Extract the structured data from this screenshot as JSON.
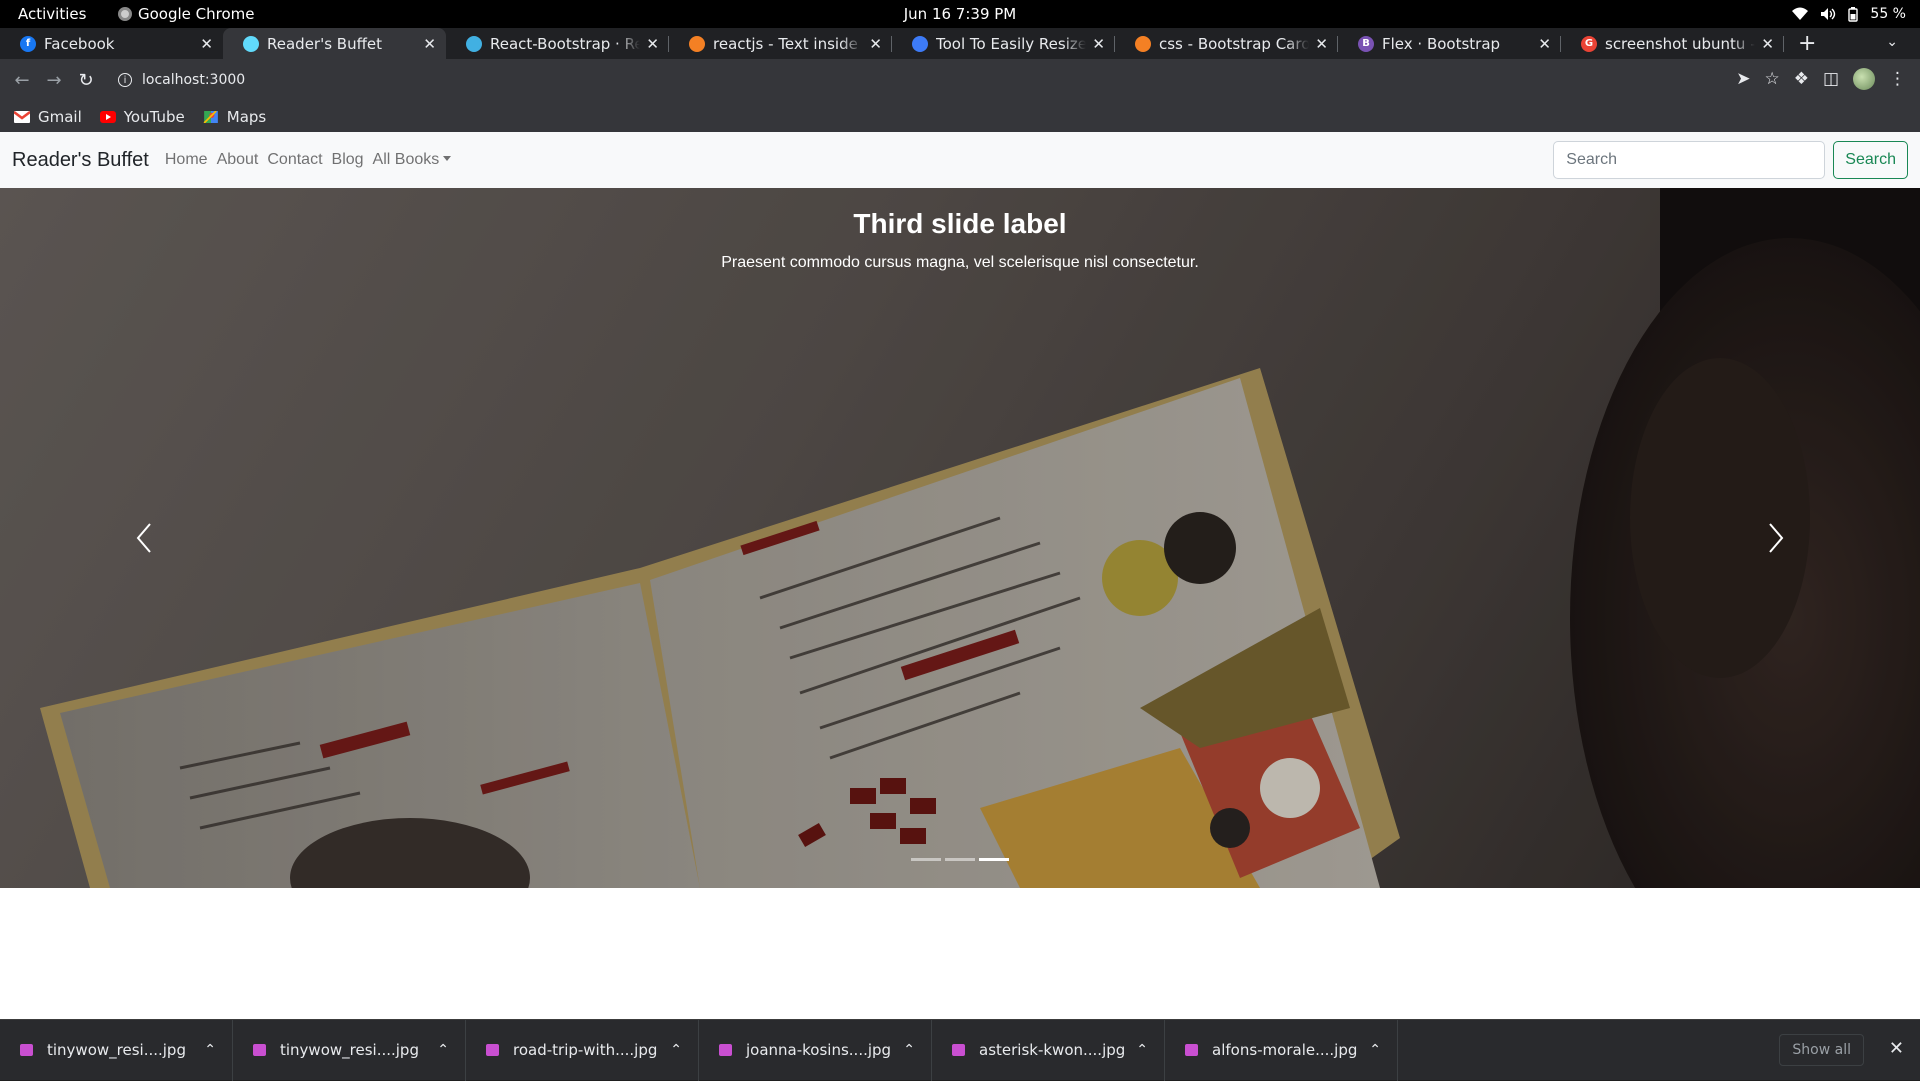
{
  "os": {
    "activities": "Activities",
    "app_name": "Google Chrome",
    "clock": "Jun 16  7:39 PM",
    "battery": "55 %"
  },
  "tabs": [
    {
      "title": "Facebook",
      "favicon_color": "#1877f2",
      "favicon_glyph": "f",
      "active": false
    },
    {
      "title": "Reader's Buffet",
      "favicon_color": "#61dafb",
      "favicon_glyph": "",
      "active": true
    },
    {
      "title": "React-Bootstrap · React",
      "favicon_color": "#41b0e2",
      "favicon_glyph": "",
      "active": false
    },
    {
      "title": "reactjs - Text inside rea",
      "favicon_color": "#f48024",
      "favicon_glyph": "",
      "active": false
    },
    {
      "title": "Tool To Easily Resize an",
      "favicon_color": "#3d7bf7",
      "favicon_glyph": "",
      "active": false
    },
    {
      "title": "css - Bootstrap Carousel",
      "favicon_color": "#f48024",
      "favicon_glyph": "",
      "active": false
    },
    {
      "title": "Flex · Bootstrap",
      "favicon_color": "#7952b3",
      "favicon_glyph": "B",
      "active": false
    },
    {
      "title": "screenshot ubuntu - Go",
      "favicon_color": "#ea4335",
      "favicon_glyph": "G",
      "active": false
    }
  ],
  "toolbar": {
    "url": "localhost:3000"
  },
  "bookmarks": [
    {
      "label": "Gmail",
      "icon": "gmail-icon"
    },
    {
      "label": "YouTube",
      "icon": "youtube-icon"
    },
    {
      "label": "Maps",
      "icon": "maps-icon"
    }
  ],
  "site": {
    "brand": "Reader's Buffet",
    "nav": [
      "Home",
      "About",
      "Contact",
      "Blog"
    ],
    "dropdown_label": "All Books",
    "search_placeholder": "Search",
    "search_button": "Search"
  },
  "carousel": {
    "title": "Third slide label",
    "text": "Praesent commodo cursus magna, vel scelerisque nisl consectetur.",
    "slide_count": 3,
    "active_index": 2
  },
  "downloads": [
    {
      "name": "tinywow_resi....jpg"
    },
    {
      "name": "tinywow_resi....jpg"
    },
    {
      "name": "road-trip-with....jpg"
    },
    {
      "name": "joanna-kosins....jpg"
    },
    {
      "name": "asterisk-kwon....jpg"
    },
    {
      "name": "alfons-morale....jpg"
    }
  ],
  "shelf": {
    "show_all": "Show all"
  }
}
